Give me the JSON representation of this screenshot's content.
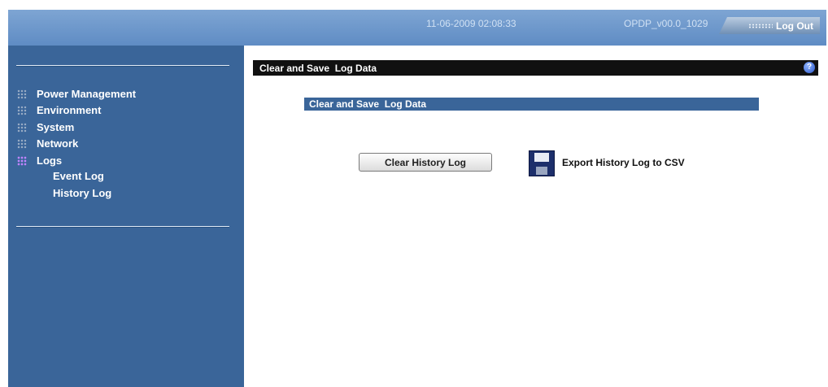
{
  "header": {
    "datetime": "11-06-2009 02:08:33",
    "version": "OPDP_v00.0_1029",
    "logout_label": "Log Out"
  },
  "sidebar": {
    "items": [
      {
        "label": "Power Management",
        "icon": "grid-icon"
      },
      {
        "label": "Environment",
        "icon": "grid-icon"
      },
      {
        "label": "System",
        "icon": "grid-icon"
      },
      {
        "label": "Network",
        "icon": "grid-icon"
      },
      {
        "label": "Logs",
        "icon": "grid-icon",
        "active": true
      }
    ],
    "sub_items": [
      {
        "label": "Event Log"
      },
      {
        "label": "History Log"
      }
    ]
  },
  "main": {
    "panel_title": "Clear and Save  Log Data",
    "help_icon": "?",
    "section_title": "Clear and Save  Log Data",
    "clear_button": "Clear History Log",
    "export_label": "Export History Log to CSV"
  },
  "colors": {
    "header_blue": "#6d97cb",
    "sidebar_blue": "#3a6599",
    "panel_black": "#111111",
    "active_icon": "#c084ff"
  }
}
